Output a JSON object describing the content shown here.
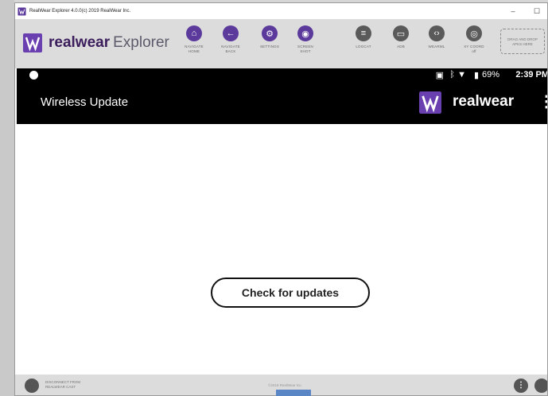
{
  "window": {
    "title": "RealWear Explorer 4.0.0(c) 2019 RealWear Inc."
  },
  "brand": {
    "name_bold": "realwear",
    "name_light": "Explorer"
  },
  "toolbar": {
    "tools": [
      {
        "label1": "NAVIGATE",
        "label2": "HOME"
      },
      {
        "label1": "NAVIGATE",
        "label2": "BACK"
      },
      {
        "label1": "SETTINGS",
        "label2": ""
      },
      {
        "label1": "SCREEN",
        "label2": "SHOT"
      },
      {
        "label1": "LOGCAT",
        "label2": ""
      },
      {
        "label1": "ADB",
        "label2": ""
      },
      {
        "label1": "WEARML",
        "label2": ""
      },
      {
        "label1": "XY COORD",
        "label2": "off"
      }
    ],
    "drop_zone": {
      "line1": "DRAG AND DROP",
      "line2": "APKS HERE"
    }
  },
  "status": {
    "battery": "69%",
    "time": "2:39 PM"
  },
  "appbar": {
    "title": "Wireless Update",
    "brand": "realwear"
  },
  "main": {
    "check_button": "Check for updates"
  },
  "footer": {
    "disconnect_line1": "DISCONNECT FROM",
    "disconnect_line2": "REALWEAR CAST",
    "copyright": "©2019 RealWear Inc."
  }
}
